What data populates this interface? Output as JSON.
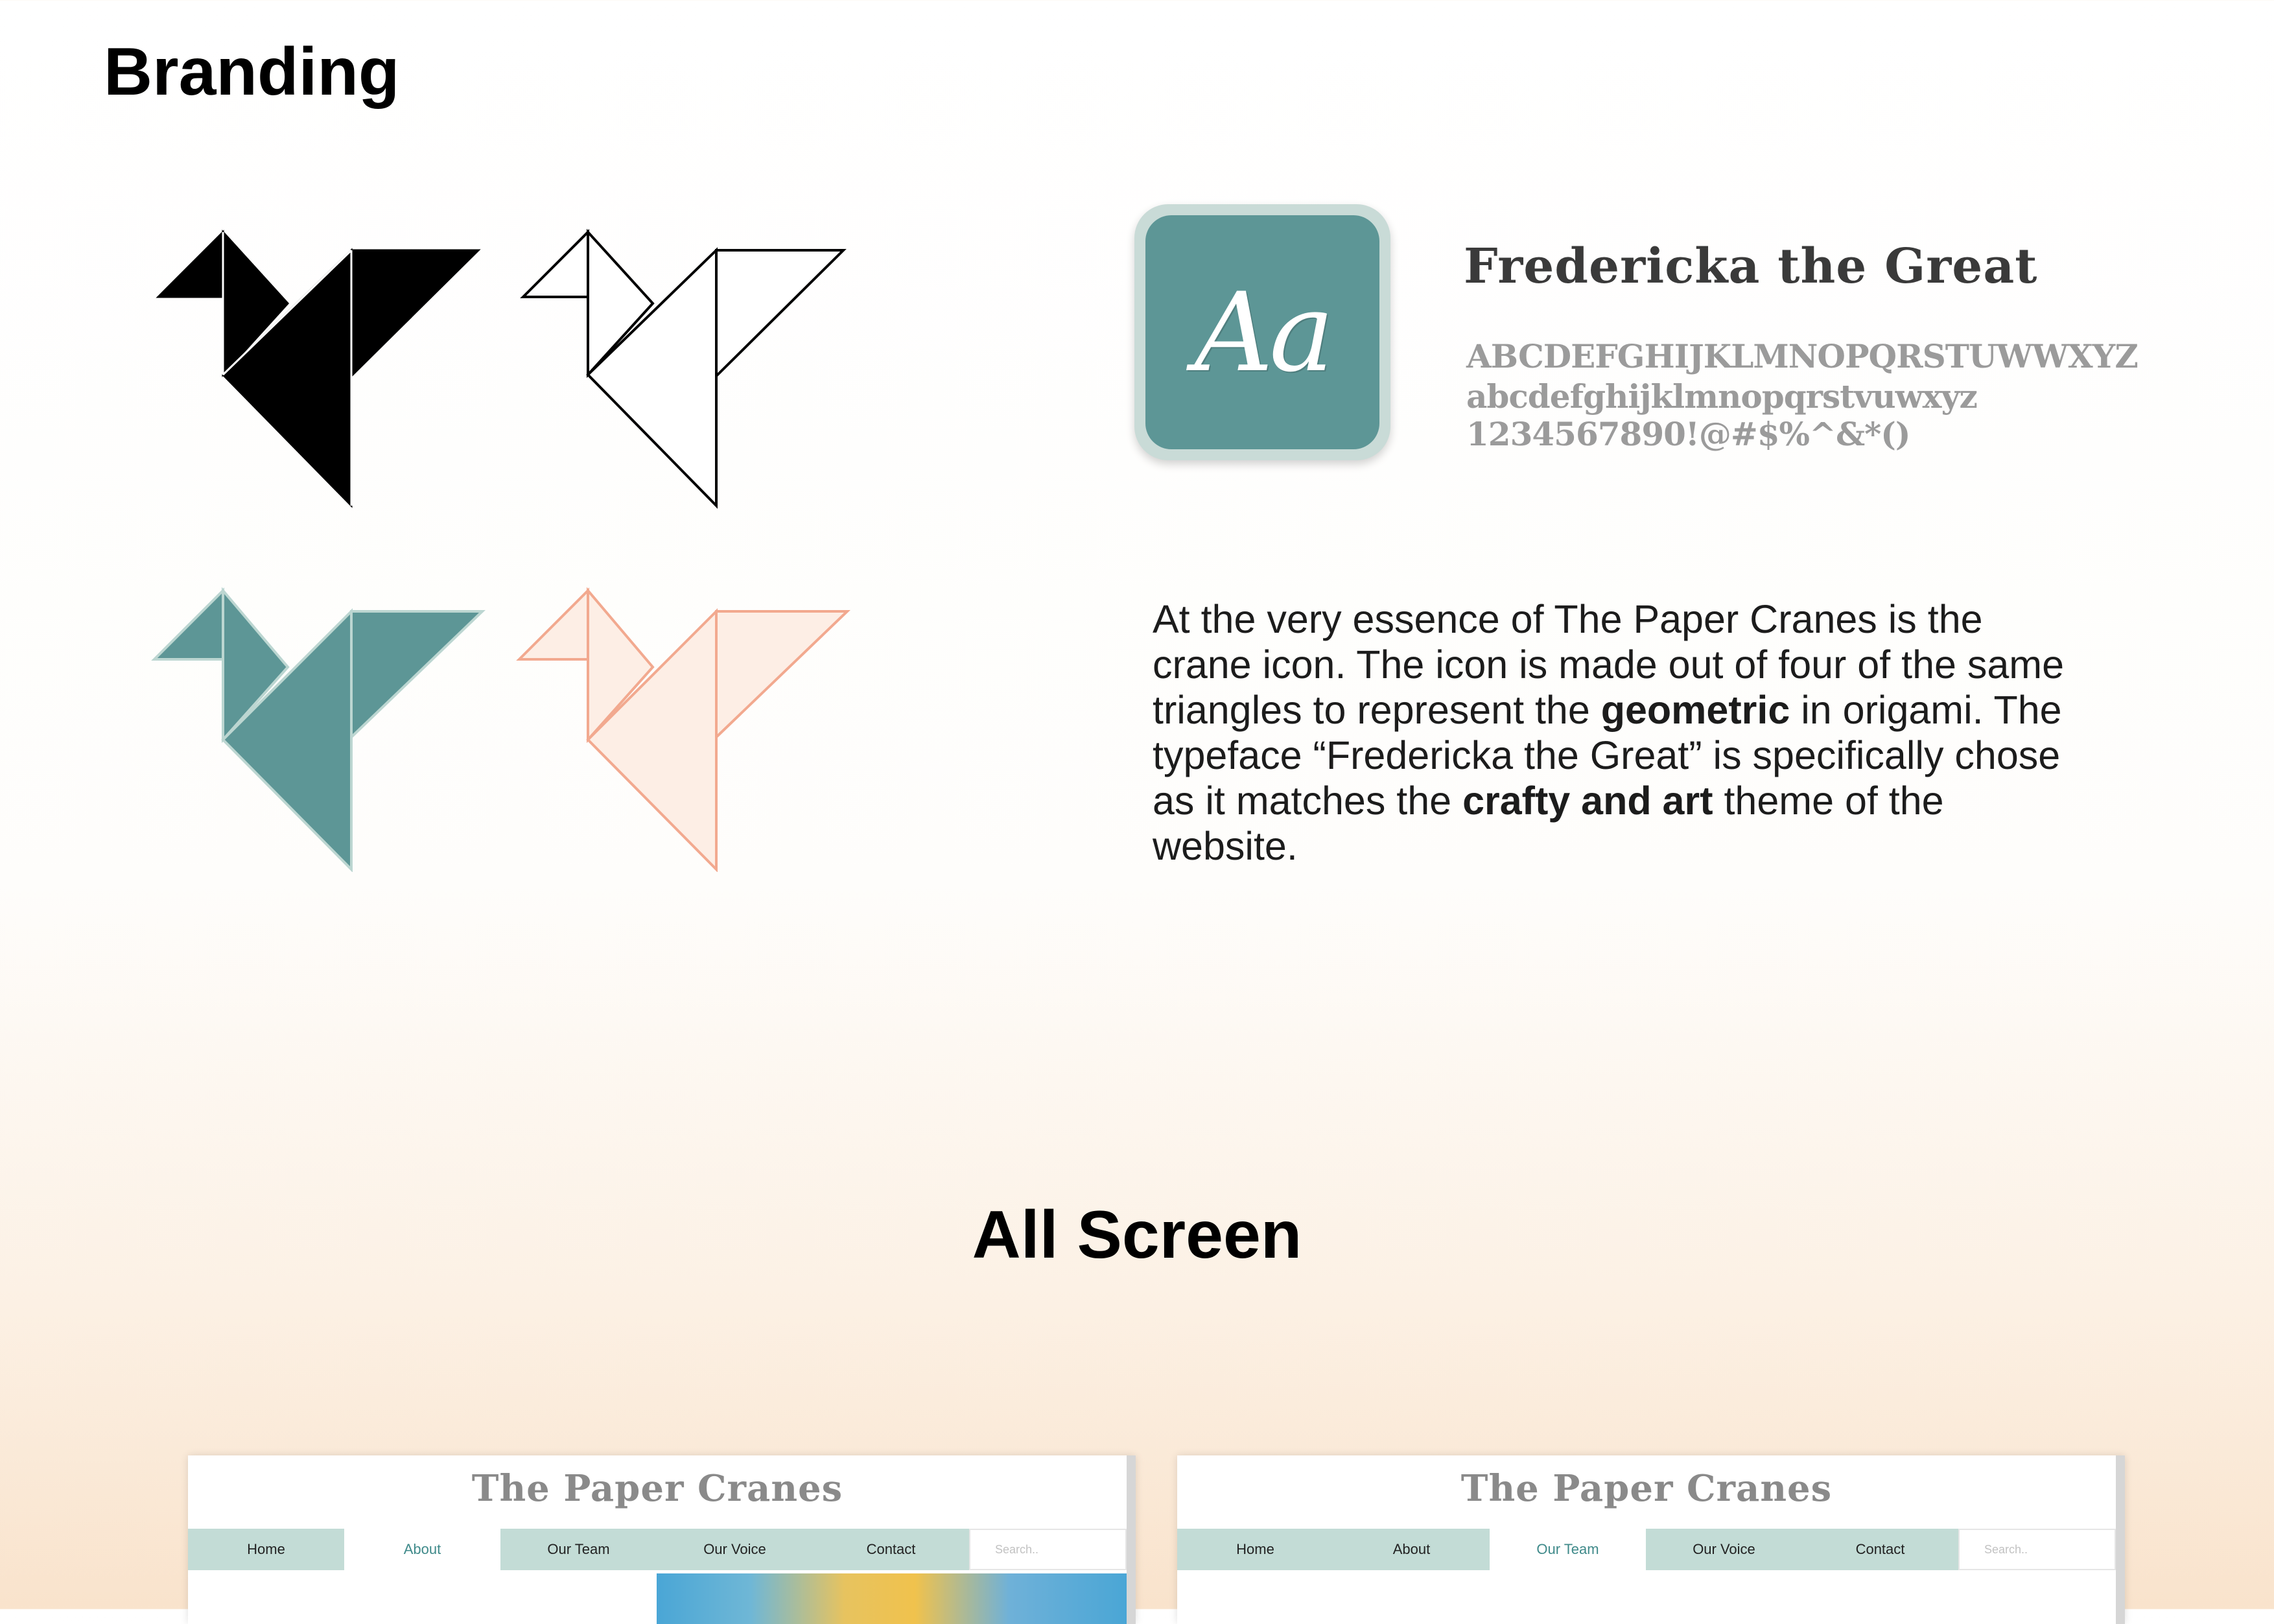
{
  "headings": {
    "branding": "Branding",
    "all_screen": "All Screen"
  },
  "logo_variants": [
    {
      "name": "black-solid",
      "fill": "#000000",
      "stroke": "#000000"
    },
    {
      "name": "black-outline",
      "fill": "#ffffff",
      "stroke": "#000000"
    },
    {
      "name": "teal-solid",
      "fill": "#5d9696",
      "stroke": "#bcd6d1"
    },
    {
      "name": "peach-outline",
      "fill": "#fdeee5",
      "stroke": "#f2a98f"
    }
  ],
  "typeface": {
    "sample": "Aa",
    "name": "Fredericka the Great",
    "uppercase": "ABCDEFGHIJKLMNOPQRSTUWWXYZ",
    "lowercase": "abcdefghijklmnopqrstvuwxyz",
    "numbers_symbols": "1234567890!@#$%^&*()",
    "tile_color": "#5d9696"
  },
  "description": {
    "part1": "At the very essence of The Paper Cranes is the crane icon. The icon is made out of four of the same triangles to represent the ",
    "bold1": "geometric",
    "part2": " in origami. The typeface “Fredericka the Great” is specifically chose as it matches the ",
    "bold2": "crafty and art",
    "part3": " theme of the website."
  },
  "screens": [
    {
      "site_title": "The Paper Cranes",
      "nav": [
        "Home",
        "About",
        "Our Team",
        "Our Voice",
        "Contact"
      ],
      "active": "About",
      "search_placeholder": "Search.."
    },
    {
      "site_title": "The Paper Cranes",
      "nav": [
        "Home",
        "About",
        "Our Team",
        "Our Voice",
        "Contact"
      ],
      "active": "Our Team",
      "search_placeholder": "Search.."
    }
  ]
}
